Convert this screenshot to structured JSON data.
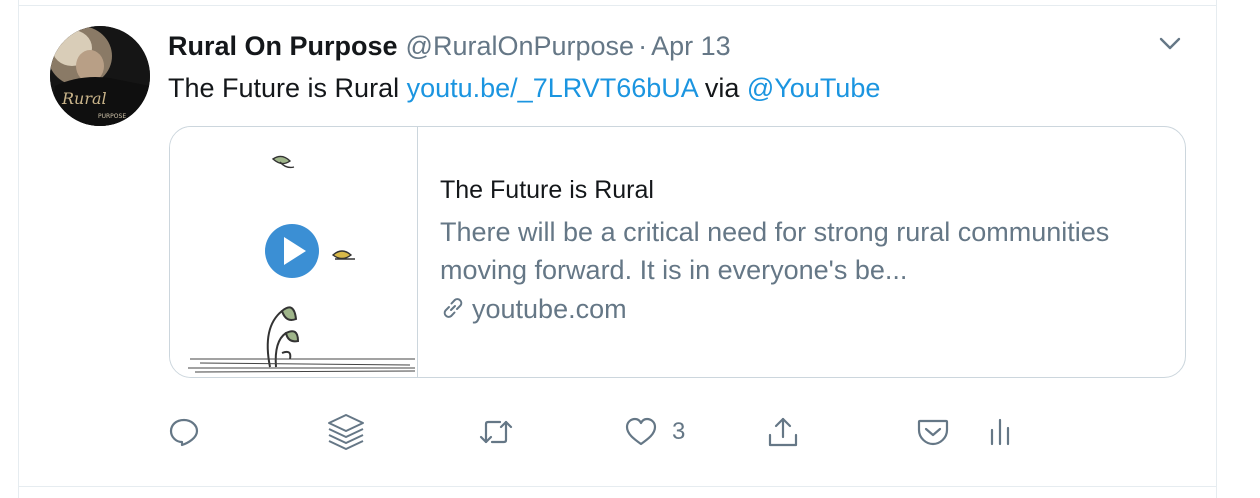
{
  "tweet": {
    "author_name": "Rural On Purpose",
    "handle": "@RuralOnPurpose",
    "separator": "·",
    "date": "Apr 13",
    "text_prefix": "The Future is Rural ",
    "link_text": "youtu.be/_7LRVT66bUA",
    "text_via": " via ",
    "mention": "@YouTube",
    "avatar_text": "Rural",
    "avatar_subtext": "PURPOSE"
  },
  "card": {
    "title": "The Future is Rural",
    "description": "There will be a critical need for strong rural communities moving forward. It is in everyone's be...",
    "domain": "youtube.com",
    "media_icons": [
      "play-button-icon",
      "leaf-illustration"
    ]
  },
  "actions": {
    "reply_icon": "reply-icon",
    "layers_icon": "layers-icon",
    "retweet_icon": "retweet-icon",
    "like_icon": "heart-icon",
    "like_count": "3",
    "share_icon": "share-icon",
    "pocket_icon": "pocket-icon",
    "analytics_icon": "analytics-icon"
  },
  "colors": {
    "link": "#1b95e0",
    "secondary_text": "#657786",
    "border": "#ccd6dd",
    "play_button": "#3b8fd4"
  }
}
